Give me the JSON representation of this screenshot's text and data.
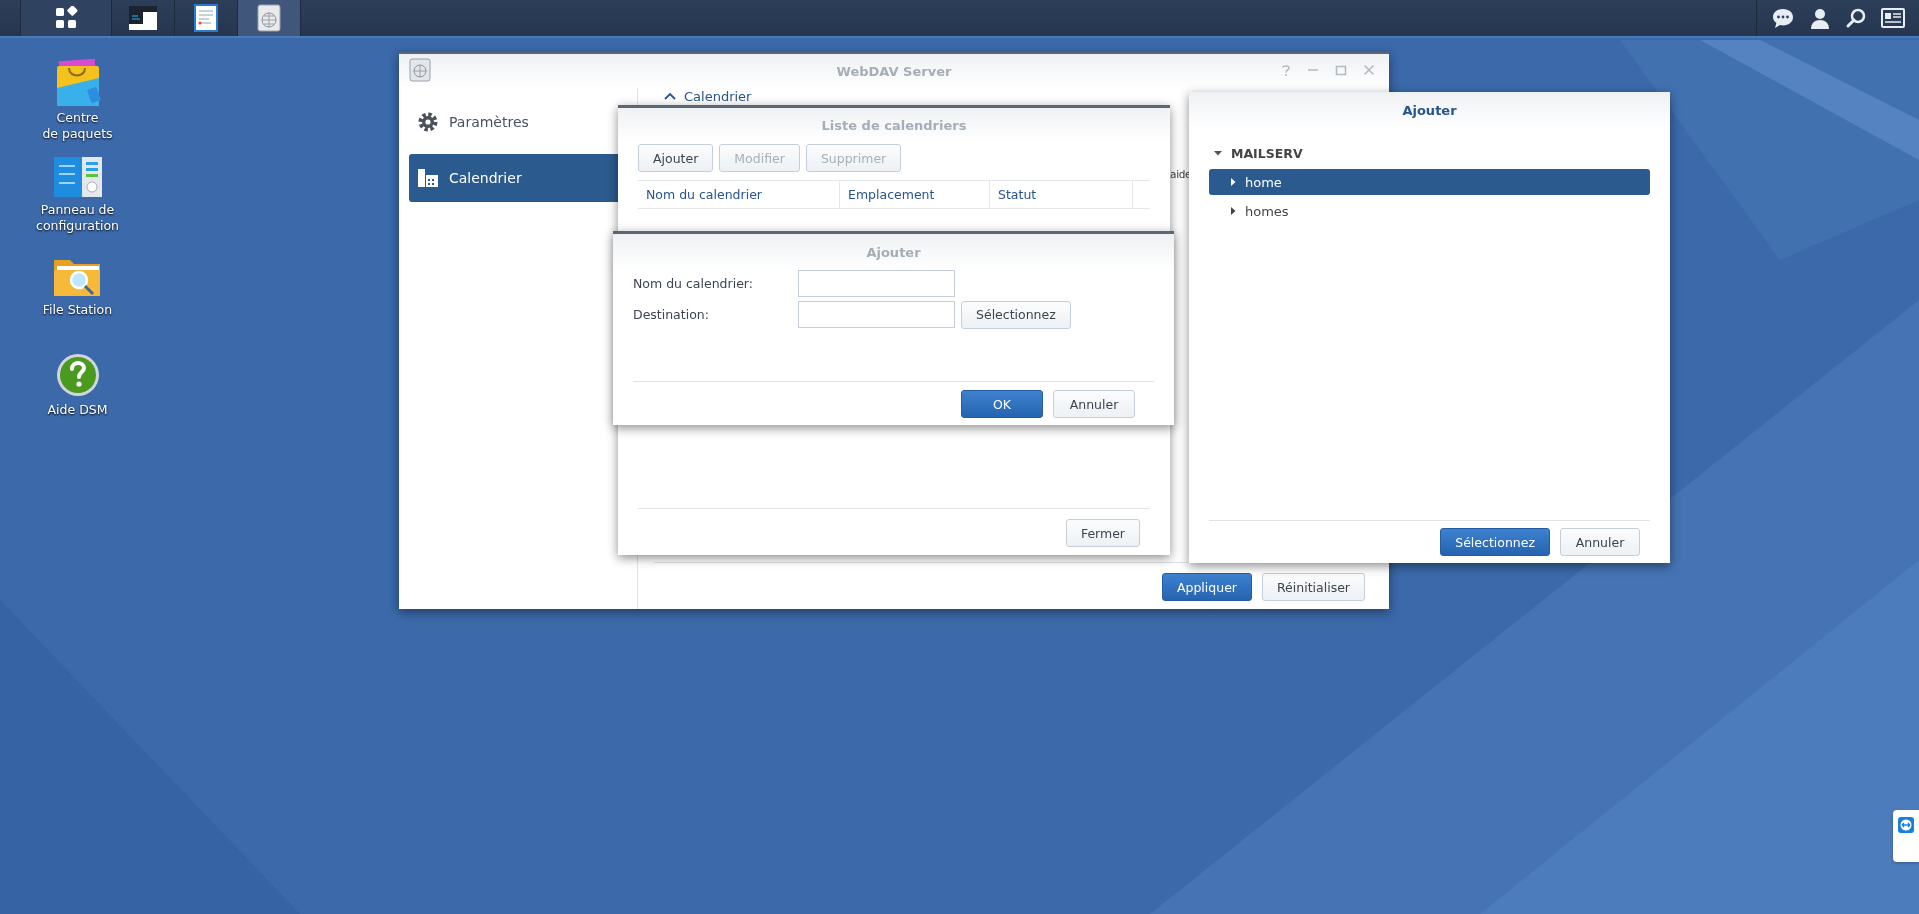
{
  "taskbar": {
    "apps": [
      {
        "kind": "terminal",
        "selected": false
      },
      {
        "kind": "document",
        "selected": false
      },
      {
        "kind": "globe",
        "selected": true
      }
    ]
  },
  "desktop_icons": [
    {
      "kind": "package",
      "label": "Centre\nde paquets"
    },
    {
      "kind": "control-panel",
      "label": "Panneau de\nconfiguration"
    },
    {
      "kind": "folder",
      "label": "File Station"
    },
    {
      "kind": "help",
      "label": "Aide DSM"
    }
  ],
  "webdav_window": {
    "title": "WebDAV Server",
    "active": false,
    "sidebar": [
      {
        "kind": "gear",
        "label": "Paramètres",
        "selected": false
      },
      {
        "kind": "calendar",
        "label": "Calendrier",
        "selected": true
      }
    ],
    "section_title": "Calendrier",
    "partial_text": "aide",
    "buttons": [
      {
        "label": "Appliquer",
        "kind": "primary"
      },
      {
        "label": "Réinitialiser",
        "kind": "default"
      }
    ]
  },
  "calendar_list_dialog": {
    "title": "Liste de calendriers",
    "active": false,
    "toolbar": [
      {
        "label": "Ajouter",
        "disabled": false
      },
      {
        "label": "Modifier",
        "disabled": true
      },
      {
        "label": "Supprimer",
        "disabled": true
      }
    ],
    "columns": [
      "Nom du calendrier",
      "Emplacement",
      "Statut"
    ],
    "buttons": [
      {
        "label": "Fermer",
        "kind": "default"
      }
    ]
  },
  "add_dialog": {
    "title": "Ajouter",
    "active": false,
    "fields": [
      {
        "kind": "text",
        "label": "Nom du calendrier:"
      },
      {
        "kind": "picker",
        "label": "Destination:",
        "button": "Sélectionnez"
      }
    ],
    "buttons": [
      {
        "label": "OK",
        "kind": "primary"
      },
      {
        "label": "Annuler",
        "kind": "default"
      }
    ]
  },
  "folder_dialog": {
    "title": "Ajouter",
    "active": true,
    "tree": [
      {
        "label": "MAILSERV",
        "expanded": true,
        "selected": false,
        "children": [
          {
            "label": "home",
            "expanded": false,
            "selected": true
          },
          {
            "label": "homes",
            "expanded": false,
            "selected": false
          }
        ]
      }
    ],
    "buttons": [
      {
        "label": "Sélectionnez",
        "kind": "primary"
      },
      {
        "label": "Annuler",
        "kind": "default"
      }
    ]
  }
}
